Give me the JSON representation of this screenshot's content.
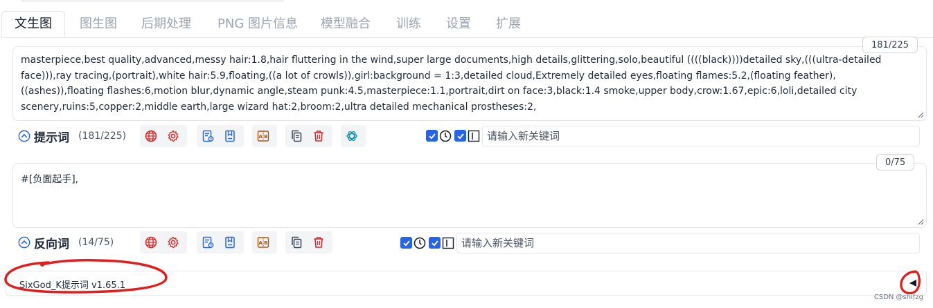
{
  "tabs": [
    {
      "label": "文生图",
      "active": true
    },
    {
      "label": "图生图"
    },
    {
      "label": "后期处理"
    },
    {
      "label": "PNG 图片信息"
    },
    {
      "label": "模型融合"
    },
    {
      "label": "训练"
    },
    {
      "label": "设置"
    },
    {
      "label": "扩展"
    }
  ],
  "prompt": {
    "text": "masterpiece,best quality,advanced,messy hair:1.8,hair fluttering in the wind,super large documents,high details,glittering,solo,beautiful ((((black))))detailed sky,(((ultra-detailed face))),ray tracing,(portrait),white hair:5.9,floating,((a lot of crowls)),girl:background = 1:3,detailed cloud,Extremely detailed eyes,floating flames:5.2,(floating feather),((ashes)),floating flashes:6,motion blur,dynamic angle,steam punk:4.5,masterpiece:1.1,portrait,dirt on face:3,black:1.4 smoke,upper body,crow:1.67,epic:6,loli,detailed city scenery,ruins:5,copper:2,middle earth,large wizard hat:2,broom:2,ultra detailed mechanical prostheses:2,",
    "token_counter": "181/225",
    "toolbar_title": "提示词",
    "toolbar_count": "(181/225)",
    "keyword_placeholder": "请输入新关键词"
  },
  "negative": {
    "text": "#[负面起手],",
    "token_counter": "0/75",
    "toolbar_title": "反向词",
    "toolbar_count": "(14/75)",
    "keyword_placeholder": "请输入新关键词"
  },
  "footer": {
    "label": "SixGod_K提示词 v1.65.1"
  },
  "watermark": "CSDN @shifzg",
  "icons": {
    "translate": "globe-icon",
    "settings": "gear-icon",
    "history": "history-list-icon",
    "favorites": "bookmark-icon",
    "ab": "ab-swap-icon",
    "copy": "copy-icon",
    "delete": "trash-icon",
    "ai": "openai-icon"
  },
  "colors": {
    "accent_blue": "#2563eb",
    "icon_red": "#dc2626",
    "icon_blue": "#2563eb",
    "icon_gold": "#b45309",
    "icon_teal": "#0891b2",
    "annotation_red": "#e11d1d"
  }
}
